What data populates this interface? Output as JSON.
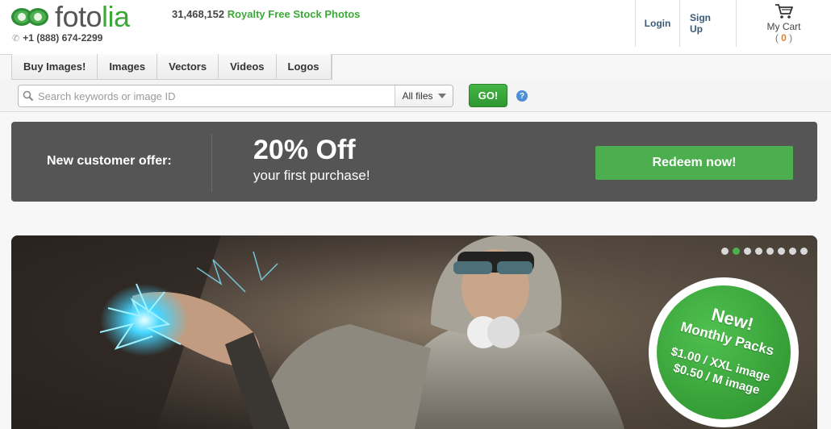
{
  "header": {
    "logo_part1": "foto",
    "logo_part2": "lia",
    "phone": "+1 (888) 674-2299",
    "stock_count": "31,468,152",
    "stock_label": "Royalty Free Stock Photos",
    "login": "Login",
    "signup": "Sign Up",
    "cart_label": "My Cart",
    "cart_count": "0"
  },
  "nav": {
    "items": [
      "Buy Images!",
      "Images",
      "Vectors",
      "Videos",
      "Logos"
    ]
  },
  "search": {
    "placeholder": "Search keywords or image ID",
    "filter": "All files",
    "go": "GO!",
    "help": "?"
  },
  "offer": {
    "label": "New customer offer:",
    "percent": "20% Off",
    "sub": "your first purchase!",
    "redeem": "Redeem now!"
  },
  "hero": {
    "badge_line1": "New!",
    "badge_line2": "Monthly Packs",
    "badge_line3": "$1.00 / XXL image",
    "badge_line4": "$0.50 / M image",
    "active_slide": 2,
    "slide_count": 8
  },
  "colors": {
    "brand_green": "#3aa935",
    "offer_bg": "#555555",
    "redeem": "#4cae4f",
    "link": "#3b5a78"
  }
}
